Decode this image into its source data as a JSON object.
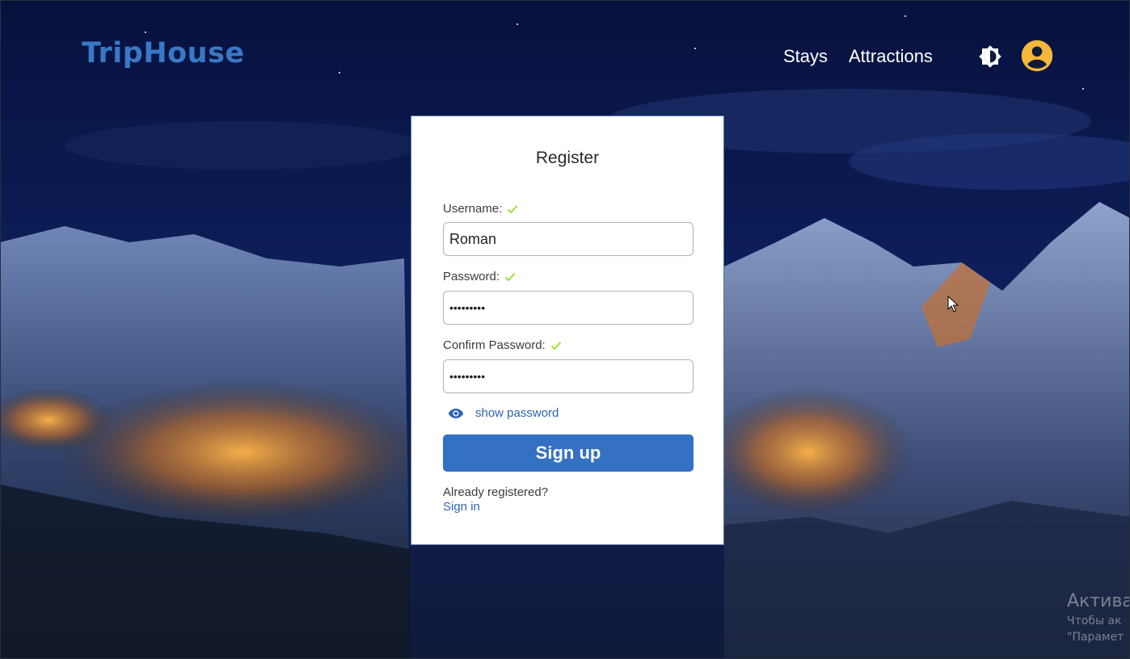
{
  "brand": {
    "logo": "TripHouse",
    "color": "#3a78c6"
  },
  "nav": {
    "stays": "Stays",
    "attractions": "Attractions"
  },
  "icons": {
    "theme": "brightness-icon",
    "account": "account-circle-icon",
    "account_color": "#f3b83a"
  },
  "form": {
    "title": "Register",
    "username_label": "Username:",
    "username_value": "Roman",
    "password_label": "Password:",
    "password_value": "•••••••••",
    "confirm_label": "Confirm Password:",
    "confirm_value": "•••••••••",
    "show_password": "show password",
    "submit": "Sign up",
    "already": "Already registered?",
    "signin": "Sign in",
    "accent": "#3471c4",
    "check_color": "#9ee03a"
  },
  "watermark": {
    "title": "Актива",
    "line1": "Чтобы ак",
    "line2": "\"Парамет"
  }
}
